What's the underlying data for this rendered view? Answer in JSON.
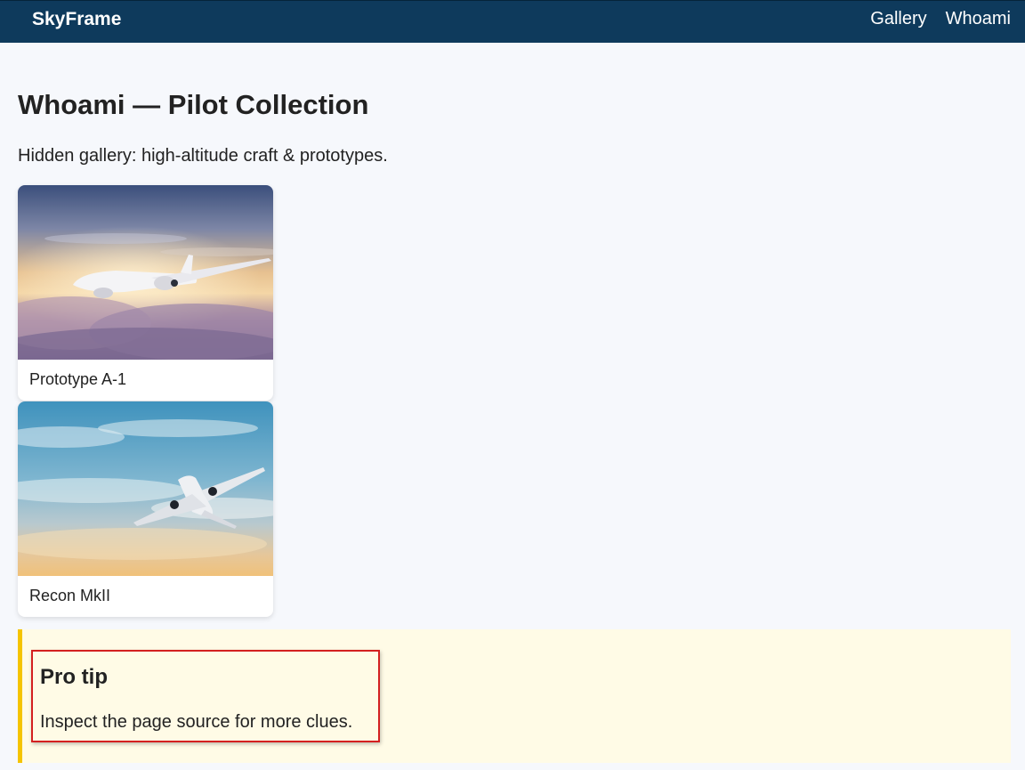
{
  "header": {
    "brand": "SkyFrame",
    "nav": [
      {
        "label": "Gallery"
      },
      {
        "label": "Whoami"
      }
    ],
    "bg_color": "#0e3a5c"
  },
  "main": {
    "title": "Whoami — Pilot Collection",
    "subtitle": "Hidden gallery: high-altitude craft & prototypes.",
    "cards": [
      {
        "caption": "Prototype A-1",
        "image": "airliner-above-sunset-clouds"
      },
      {
        "caption": "Recon MkII",
        "image": "airliner-climbing-blue-sky"
      }
    ]
  },
  "tip": {
    "title": "Pro tip",
    "text": "Inspect the page source for more clues.",
    "accent_color": "#f5c400",
    "highlight_color": "#d42020"
  }
}
